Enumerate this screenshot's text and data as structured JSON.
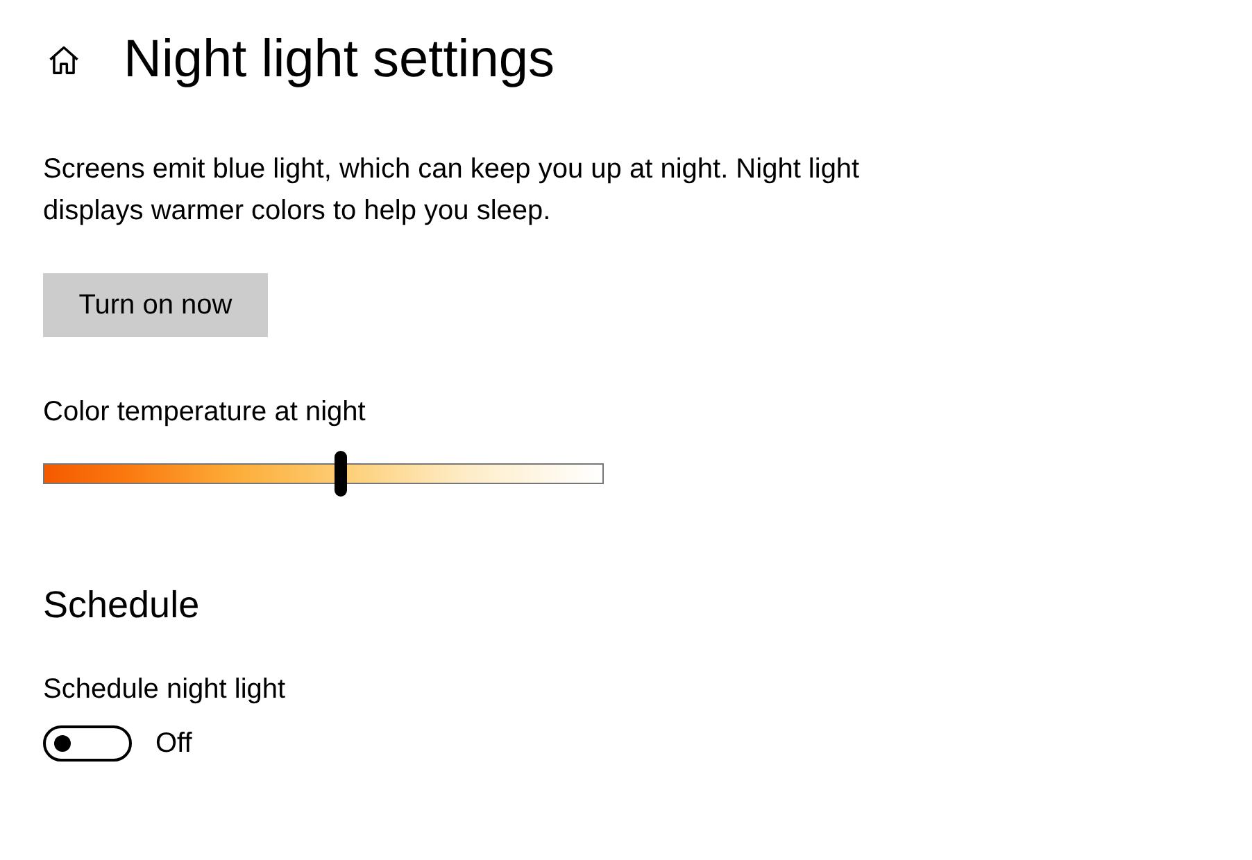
{
  "header": {
    "title": "Night light settings"
  },
  "description": "Screens emit blue light, which can keep you up at night. Night light displays warmer colors to help you sleep.",
  "turn_on_button": "Turn on now",
  "color_temperature": {
    "label": "Color temperature at night",
    "level": 0.53
  },
  "schedule": {
    "heading": "Schedule",
    "toggle_label": "Schedule night light",
    "on": false,
    "state_text": "Off"
  }
}
